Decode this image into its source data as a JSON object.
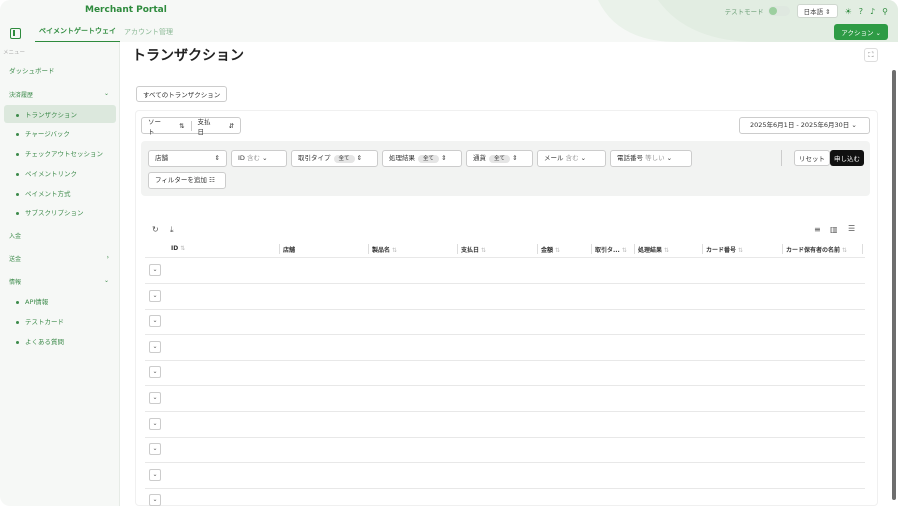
{
  "header": {
    "brand": "Merchant Portal",
    "tabs": [
      {
        "label": "ペイメントゲートウェイ",
        "active": true
      },
      {
        "label": "アカウント管理",
        "active": false
      }
    ],
    "test_mode_label": "テストモード",
    "language": "日本語",
    "action_label": "アクション",
    "brand_color": "#2e8b3d"
  },
  "sidebar": {
    "caption": "メニュー",
    "dashboard": "ダッシュボード",
    "groups": {
      "payments": "決済履歴",
      "transactions": "トランザクション",
      "chargeback": "チャージバック",
      "checkout": "チェックアウトセッション",
      "payment_link": "ペイメントリンク",
      "payment_method": "ペイメント方式",
      "subscription": "サブスクリプション",
      "deposits": "入金",
      "remittance": "送金",
      "info": "情報",
      "api": "API情報",
      "test_card": "テストカード",
      "faq": "よくある質問"
    }
  },
  "main": {
    "title": "トランザクション",
    "all_transactions": "すべてのトランザクション",
    "sort_label": "ソート",
    "sort_field": "支払日",
    "date_range": "2025年6月1日 - 2025年6月30日",
    "filters": {
      "store": "店舗",
      "id": "ID",
      "id_op": "含む",
      "tx_type": "取引タイプ",
      "tx_type_val": "全て",
      "result": "処理結果",
      "result_val": "全て",
      "currency": "通貨",
      "currency_val": "全て",
      "email": "メール",
      "email_op": "含む",
      "phone": "電話番号",
      "phone_op": "等しい",
      "add_filter": "フィルターを追加"
    },
    "reset_label": "リセット",
    "apply_label": "申し込む",
    "columns": [
      "ID",
      "店舗",
      "製品名",
      "支払日",
      "金額",
      "取引タ...",
      "処理結果",
      "カード番号",
      "カード保有者の名前"
    ]
  }
}
